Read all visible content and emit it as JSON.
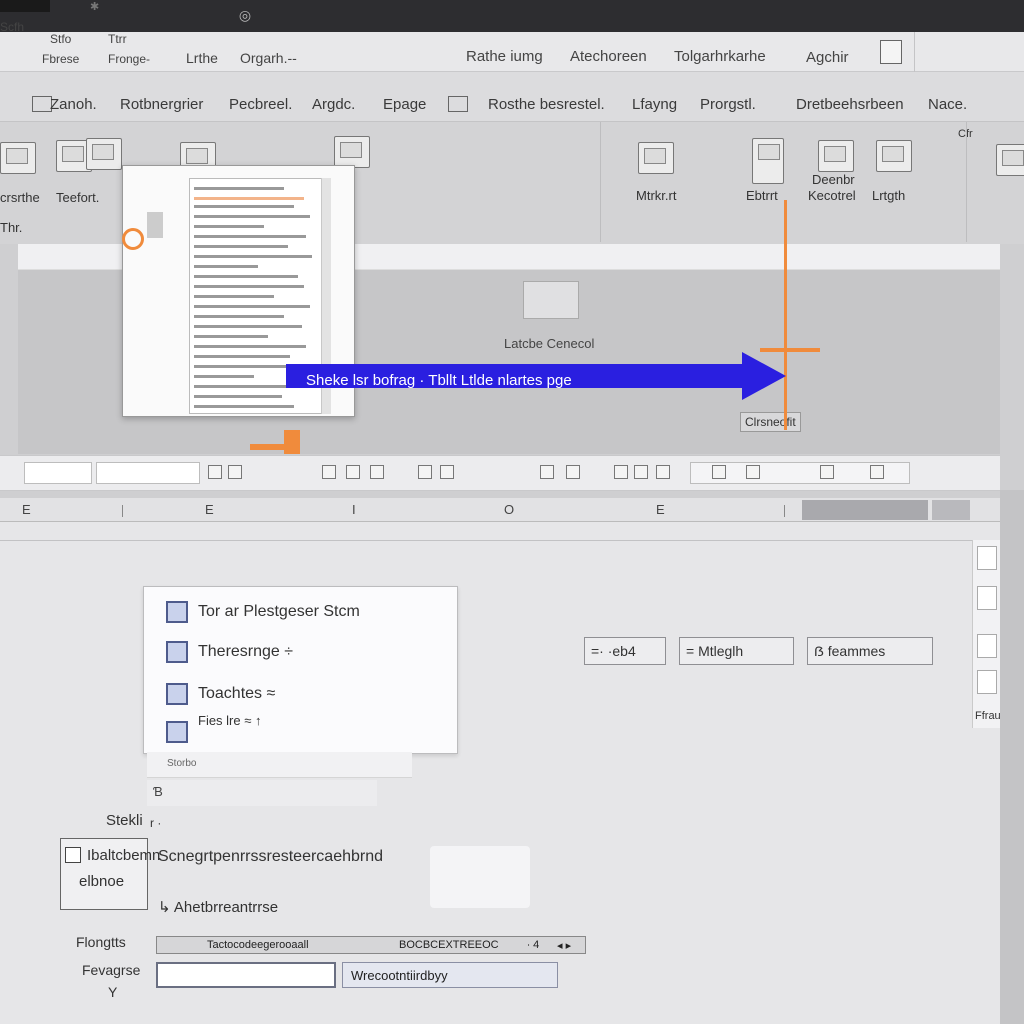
{
  "titlebar": {
    "glyph": "✱",
    "app_glyph": "◎"
  },
  "menubar": {
    "left_stack": [
      {
        "top": "Scfh",
        "bottom": ""
      },
      {
        "top": "Stfo",
        "bottom": "Fbrese"
      },
      {
        "top": "Ttrr",
        "bottom": "Fronge-"
      }
    ],
    "items": [
      "Lrthe",
      "Orgarh.--",
      "Rathe iumg",
      "Atechoreen",
      "Tolgarhrkarhe",
      "Agchir"
    ]
  },
  "ribbon": {
    "tabs": [
      "Zanoh.",
      "Rotbnergrier",
      "Pecbreel.",
      "Argdc.",
      "Epage",
      "Rosthe besrestel.",
      "Lfayng",
      "Prorgstl.",
      "Dretbeehsrbeen",
      "Nace."
    ],
    "groups": [
      {
        "label": "crsrthe"
      },
      {
        "label": "Teefort."
      },
      {
        "label": "Mtrkr.rt"
      },
      {
        "label": "Ebtrrt"
      },
      {
        "label": "Deenbr"
      },
      {
        "label": "Kecotrel"
      },
      {
        "label": "Lrtgth"
      }
    ],
    "sub_label": "Thr.",
    "corner": "Cfr"
  },
  "main_window": {
    "center_label": "Latcbe Cenecol",
    "right_label": "Clrsneofit"
  },
  "callout": {
    "text": "Sheke lsr bofrag  ·  Tbllt Ltlde nlartes pge"
  },
  "ruler": {
    "marks": [
      "E",
      "E",
      "I",
      "O",
      "E"
    ]
  },
  "checkbox_panel": {
    "items": [
      {
        "label": "Tor ar Plestgeser Stcm"
      },
      {
        "label": "Theresrnge ÷"
      },
      {
        "label": "Toachtes ≈"
      },
      {
        "label": "Fies lre ≈ ↑"
      }
    ],
    "strip_text": "Storbo",
    "strip2_text": "Ɓ"
  },
  "fields": [
    {
      "text": "=· ·eb4"
    },
    {
      "text": "= Mtleglh"
    },
    {
      "text": "ẞ feammes"
    }
  ],
  "rail": {
    "label": "Ffrau"
  },
  "form": {
    "label_left": "Stekli",
    "label_left_suffix": "r ·",
    "box_line1": "Ibaltcbemn",
    "box_line2": "elbnoe",
    "long_text": "Scnegrtpenrrssresteercaehbrnd",
    "label_mid": "↳ Ahetbrreantrrse",
    "row1_label": "Flongtts",
    "row2_label": "Fevagrse",
    "row3_label": "Y",
    "hdr_cells": [
      "Tactocodeegerooaall",
      "BOCBCEXTREEOC",
      "∙ 4",
      "◂ ▸"
    ],
    "input_b_value": "Wrecootntiirdbyy"
  }
}
